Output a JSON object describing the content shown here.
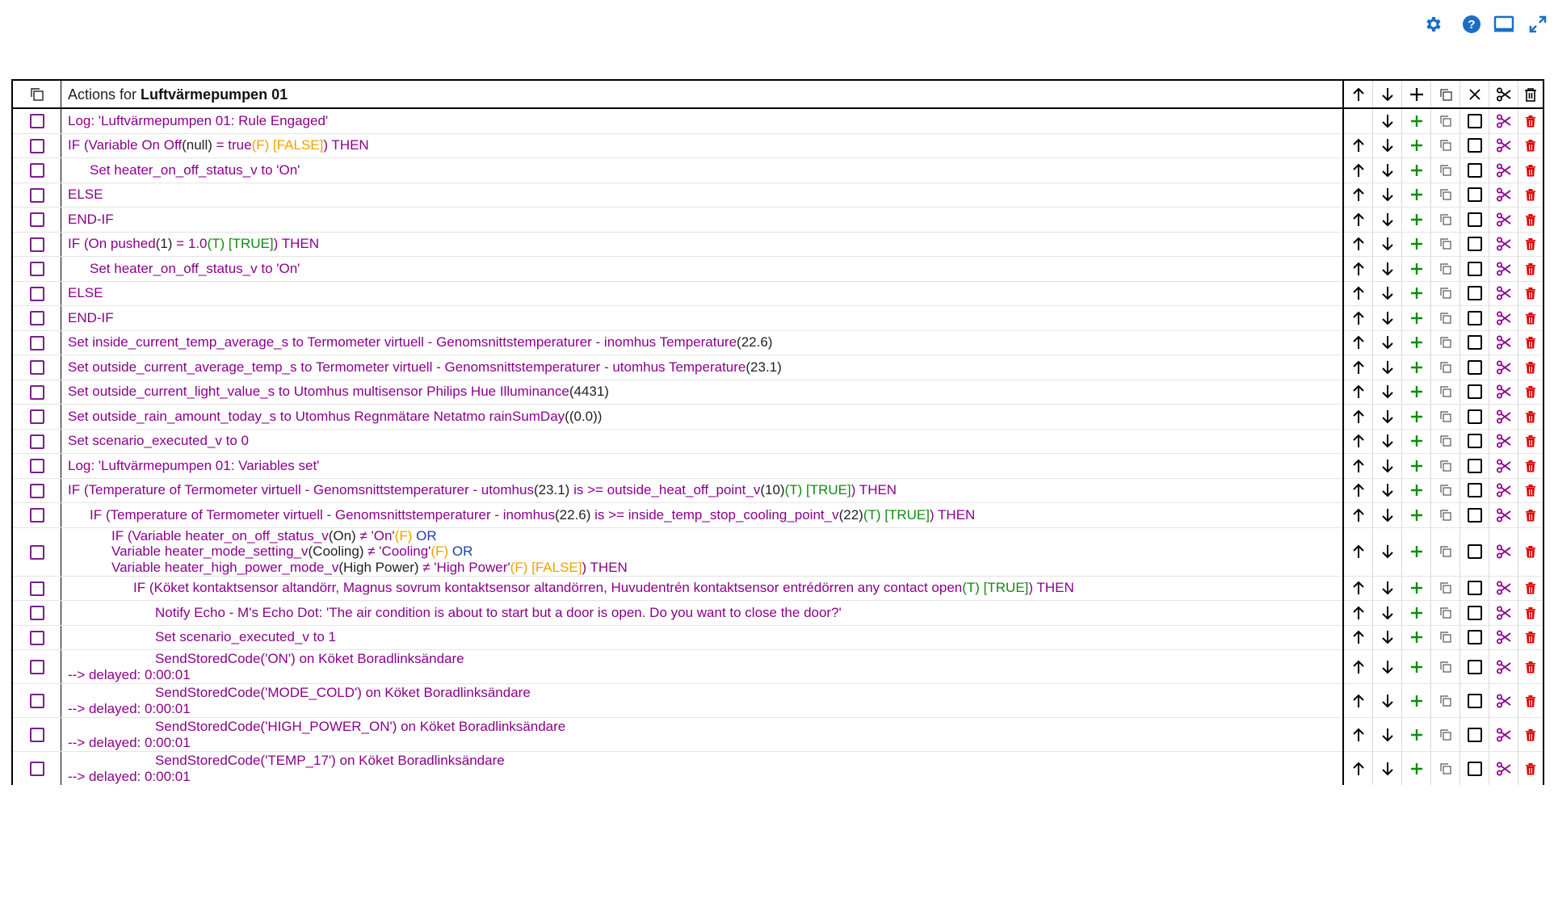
{
  "header": {
    "actions_prefix": "Actions for ",
    "device_name": "Luftvärmepumpen 01"
  },
  "top_icons": [
    "settings-gear-icon",
    "help-icon",
    "monitor-icon",
    "expand-icon"
  ],
  "colors": {
    "purple": "#8b008b",
    "orange": "#f0a000",
    "green": "#118a11",
    "blue": "#1d3faa",
    "red": "#e00000",
    "icon_blue": "#1a6fc4"
  },
  "rows": [
    {
      "segs": [
        {
          "t": "Log: 'Luftvärmepumpen 01: Rule Engaged'"
        }
      ],
      "indent": 0,
      "up": false
    },
    {
      "segs": [
        {
          "t": "IF (Variable On Off"
        },
        {
          "t": "(null)",
          "c": "dark"
        },
        {
          "t": " = true"
        },
        {
          "t": "(F) [FALSE]",
          "c": "orange"
        },
        {
          "t": ") THEN"
        }
      ],
      "indent": 0,
      "up": true
    },
    {
      "segs": [
        {
          "t": "Set heater_on_off_status_v to 'On'"
        }
      ],
      "indent": 1,
      "up": true
    },
    {
      "segs": [
        {
          "t": "ELSE"
        }
      ],
      "indent": 0,
      "up": true
    },
    {
      "segs": [
        {
          "t": "END-IF"
        }
      ],
      "indent": 0,
      "up": true
    },
    {
      "segs": [
        {
          "t": "IF (On pushed"
        },
        {
          "t": "(1)",
          "c": "dark"
        },
        {
          "t": " = 1.0"
        },
        {
          "t": "(T) [TRUE]",
          "c": "green"
        },
        {
          "t": ") THEN"
        }
      ],
      "indent": 0,
      "up": true
    },
    {
      "segs": [
        {
          "t": "Set heater_on_off_status_v to 'On'"
        }
      ],
      "indent": 1,
      "up": true
    },
    {
      "segs": [
        {
          "t": "ELSE"
        }
      ],
      "indent": 0,
      "up": true
    },
    {
      "segs": [
        {
          "t": "END-IF"
        }
      ],
      "indent": 0,
      "up": true
    },
    {
      "segs": [
        {
          "t": "Set inside_current_temp_average_s to Termometer virtuell - Genomsnittstemperaturer - inomhus Temperature"
        },
        {
          "t": "(22.6)",
          "c": "dark"
        }
      ],
      "indent": 0,
      "up": true
    },
    {
      "segs": [
        {
          "t": "Set outside_current_average_temp_s to Termometer virtuell - Genomsnittstemperaturer - utomhus Temperature"
        },
        {
          "t": "(23.1)",
          "c": "dark"
        }
      ],
      "indent": 0,
      "up": true
    },
    {
      "segs": [
        {
          "t": "Set outside_current_light_value_s to Utomhus multisensor Philips Hue Illuminance"
        },
        {
          "t": "(4431)",
          "c": "dark"
        }
      ],
      "indent": 0,
      "up": true
    },
    {
      "segs": [
        {
          "t": "Set outside_rain_amount_today_s to Utomhus Regnmätare Netatmo rainSumDay"
        },
        {
          "t": "((0.0))",
          "c": "dark"
        }
      ],
      "indent": 0,
      "up": true
    },
    {
      "segs": [
        {
          "t": "Set scenario_executed_v to 0"
        }
      ],
      "indent": 0,
      "up": true
    },
    {
      "segs": [
        {
          "t": "Log: 'Luftvärmepumpen 01: Variables set'"
        }
      ],
      "indent": 0,
      "up": true
    },
    {
      "segs": [
        {
          "t": "IF (Temperature of Termometer virtuell - Genomsnittstemperaturer - utomhus"
        },
        {
          "t": "(23.1)",
          "c": "dark"
        },
        {
          "t": " is >= outside_heat_off_point_v"
        },
        {
          "t": "(10)",
          "c": "dark"
        },
        {
          "t": "(T) [TRUE]",
          "c": "green"
        },
        {
          "t": ") THEN"
        }
      ],
      "indent": 0,
      "up": true
    },
    {
      "segs": [
        {
          "t": "IF (Temperature of Termometer virtuell - Genomsnittstemperaturer - inomhus"
        },
        {
          "t": "(22.6)",
          "c": "dark"
        },
        {
          "t": " is >= inside_temp_stop_cooling_point_v"
        },
        {
          "t": "(22)",
          "c": "dark"
        },
        {
          "t": "(T) [TRUE]",
          "c": "green"
        },
        {
          "t": ") THEN"
        }
      ],
      "indent": 1,
      "up": true
    },
    {
      "lines": [
        {
          "indent": 2,
          "segs": [
            {
              "t": "IF (Variable heater_on_off_status_v"
            },
            {
              "t": "(On)",
              "c": "dark"
            },
            {
              "t": " ≠ 'On'"
            },
            {
              "t": "(F)",
              "c": "orange"
            },
            {
              "t": "  OR",
              "c": "blue"
            }
          ]
        },
        {
          "indent": 2,
          "segs": [
            {
              "t": "Variable heater_mode_setting_v"
            },
            {
              "t": "(Cooling)",
              "c": "dark"
            },
            {
              "t": " ≠ 'Cooling'"
            },
            {
              "t": "(F)",
              "c": "orange"
            },
            {
              "t": "  OR",
              "c": "blue"
            }
          ]
        },
        {
          "indent": 2,
          "segs": [
            {
              "t": "Variable heater_high_power_mode_v"
            },
            {
              "t": "(High Power)",
              "c": "dark"
            },
            {
              "t": " ≠ 'High Power'"
            },
            {
              "t": "(F) [FALSE]",
              "c": "orange"
            },
            {
              "t": ") THEN"
            }
          ]
        }
      ],
      "up": true
    },
    {
      "segs": [
        {
          "t": "IF (Köket kontaktsensor altandörr, Magnus sovrum kontaktsensor altandörren, Huvudentrén kontaktsensor entrédörren any contact open"
        },
        {
          "t": "(T) [TRUE]",
          "c": "green"
        },
        {
          "t": ") THEN"
        }
      ],
      "indent": 3,
      "up": true
    },
    {
      "segs": [
        {
          "t": "Notify Echo - M's Echo Dot: 'The air condition is about to start but a door is open. Do you want to close the door?'"
        }
      ],
      "indent": 4,
      "up": true
    },
    {
      "segs": [
        {
          "t": "Set scenario_executed_v to 1"
        }
      ],
      "indent": 4,
      "up": true
    },
    {
      "lines": [
        {
          "indent": 4,
          "segs": [
            {
              "t": "SendStoredCode('ON') on Köket Boradlinksändare"
            }
          ]
        },
        {
          "indent": 0,
          "segs": [
            {
              "t": "--> delayed: 0:00:01"
            }
          ]
        }
      ],
      "up": true
    },
    {
      "lines": [
        {
          "indent": 4,
          "segs": [
            {
              "t": "SendStoredCode('MODE_COLD') on Köket Boradlinksändare"
            }
          ]
        },
        {
          "indent": 0,
          "segs": [
            {
              "t": "--> delayed: 0:00:01"
            }
          ]
        }
      ],
      "up": true
    },
    {
      "lines": [
        {
          "indent": 4,
          "segs": [
            {
              "t": "SendStoredCode('HIGH_POWER_ON') on Köket Boradlinksändare"
            }
          ]
        },
        {
          "indent": 0,
          "segs": [
            {
              "t": "--> delayed: 0:00:01"
            }
          ]
        }
      ],
      "up": true
    },
    {
      "lines": [
        {
          "indent": 4,
          "segs": [
            {
              "t": "SendStoredCode('TEMP_17') on Köket Boradlinksändare"
            }
          ]
        },
        {
          "indent": 0,
          "segs": [
            {
              "t": "--> delayed: 0:00:01"
            }
          ]
        }
      ],
      "up": true
    }
  ]
}
